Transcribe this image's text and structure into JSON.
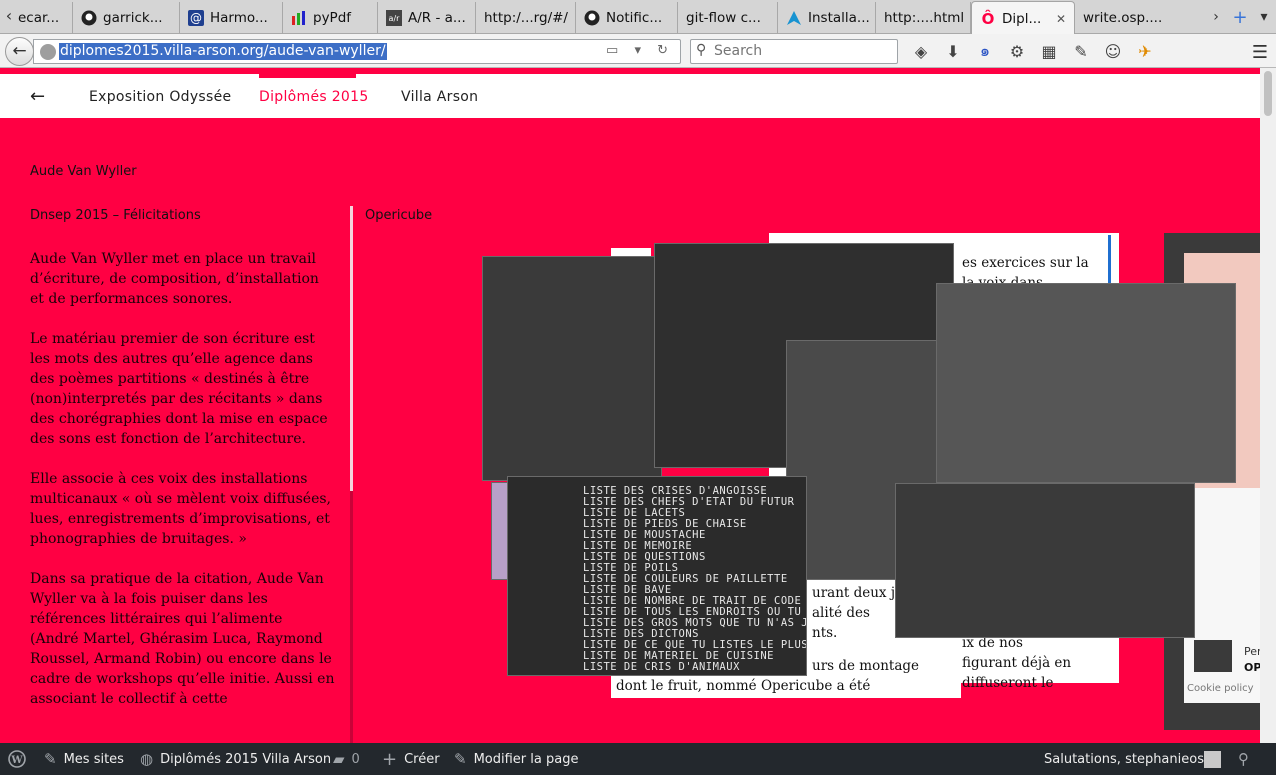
{
  "browser": {
    "tabs": [
      {
        "label": "ecar...",
        "icon": "partial-tab-icon"
      },
      {
        "label": "garrick...",
        "icon": "github-icon"
      },
      {
        "label": "Harmo...",
        "icon": "at-sign-icon"
      },
      {
        "label": "pyPdf",
        "icon": "bar-chart-icon"
      },
      {
        "label": "A/R - a...",
        "icon": "ar-site-icon"
      },
      {
        "label": "http:/...rg/#/",
        "icon": "blank-page-icon"
      },
      {
        "label": "Notific...",
        "icon": "github-icon"
      },
      {
        "label": "git-flow c...",
        "icon": "blank-page-icon"
      },
      {
        "label": "Installa...",
        "icon": "arch-linux-icon"
      },
      {
        "label": "http:....html",
        "icon": "blank-page-icon"
      },
      {
        "label": "Dipl...",
        "icon": "villa-arson-icon",
        "active": true
      },
      {
        "label": "write.osp....",
        "icon": "blank-page-icon"
      }
    ],
    "url": "diplomes2015.villa-arson.org/aude-van-wyller/",
    "search_placeholder": "Search"
  },
  "site_nav": {
    "back_arrow": "←",
    "links": [
      "Exposition Odyssée",
      "Diplômés 2015",
      "Villa Arson"
    ],
    "active_index": 1
  },
  "content": {
    "artist_name": "Aude Van Wyller",
    "subtitle": "Dnsep 2015 – Félicitations",
    "project_title": "Opericube",
    "bio_paragraphs": [
      "Aude Van Wyller met en place un travail d’écriture, de composition, d’installation et de performances sonores.",
      "Le matériau premier de son écriture est les mots des autres qu’elle agence dans des poèmes partitions « destinés à être (non)interpretés par des récitants » dans des chorégraphies dont la mise en espace des sons est fonction de l’architecture.",
      "Elle associe à ces voix des installations multicanaux « où se mèlent voix diffusées, lues, enregistrements d’improvisations, et phonographies de bruitages. »",
      "Dans sa pratique de la citation, Aude Van Wyller va à la fois puiser dans les références littéraires qui l’alimente (André Martel, Ghérasim Luca, Raymond Roussel, Armand Robin) ou encore dans le cadre de workshops qu’elle initie. Aussi en associant le collectif à cette"
    ],
    "card_fragments": {
      "top_right": [
        "es exercices sur la",
        "la voix dans"
      ],
      "mid_left": [
        "urant deux j",
        "alité des",
        "nts."
      ],
      "bottom": [
        "urs de montage",
        "dont le fruit, nommé Opericube a été"
      ],
      "bottom_right": [
        "ix de nos",
        "figurant déjà en",
        "diffuseront le"
      ]
    },
    "projection_list": [
      "LISTE DES CRISES D'ANGOISSE",
      "LISTE DES CHEFS D'ETAT DU FUTUR",
      "LISTE DE LACETS",
      "LISTE DE PIEDS DE CHAISE",
      "LISTE DE MOUSTACHE",
      "LISTE DE MEMOIRE",
      "LISTE DE QUESTIONS",
      "LISTE DE POILS",
      "LISTE DE COULEURS DE PAILLETTE",
      "LISTE DE BAVE",
      "LISTE DE NOMBRE DE TRAIT DE CODE",
      "LISTE DE TOUS LES ENDROITS OU TU",
      "LISTE DES GROS MOTS QUE TU N'AS JA",
      "LISTE DES DICTONS",
      "LISTE DE CE QUE TU LISTES LE PLUS",
      "LISTE DE MATERIEL DE CUISINE",
      "LISTE DE CRIS D'ANIMAUX"
    ],
    "side_panel": {
      "cookie_text": "Cookie policy",
      "fragment_1": "Per",
      "fragment_2": "OP"
    }
  },
  "admin_bar": {
    "items": [
      "Mes sites",
      "Diplômés 2015 Villa Arson",
      "0",
      "Créer",
      "Modifier la page"
    ],
    "greeting": "Salutations, stephanieosp"
  },
  "colors": {
    "accent": "#ff0043",
    "admin_bar": "#23282d"
  }
}
